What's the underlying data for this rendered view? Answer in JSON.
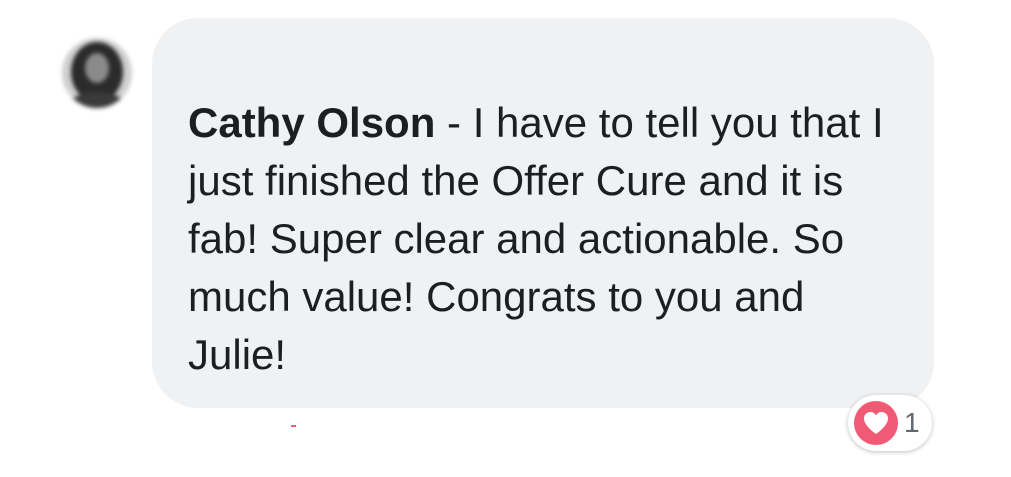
{
  "comment": {
    "author": "Cathy Olson",
    "separator": " - ",
    "text": "I have to tell you that I just finished the Offer Cure and it is fab!  Super clear and actionable. So much value! Congrats to you and Julie!"
  },
  "reaction": {
    "icon": "heart-icon",
    "count": "1",
    "color": "#f15a75"
  },
  "colors": {
    "bubble": "#f0f1f3",
    "text": "#1c1e21"
  }
}
